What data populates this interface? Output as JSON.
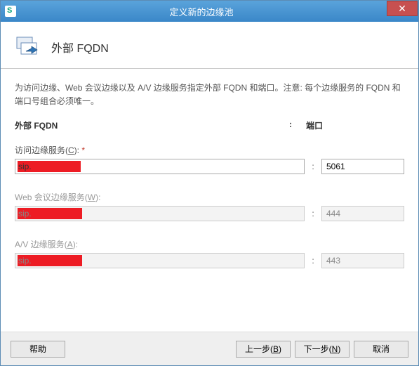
{
  "window": {
    "title": "定义新的边缘池"
  },
  "header": {
    "title": "外部 FQDN"
  },
  "description": "为访问边缘、Web 会议边缘以及 A/V 边缘服务指定外部 FQDN 和端口。注意: 每个边缘服务的 FQDN 和端口号组合必须唯一。",
  "columns": {
    "fqdn": "外部 FQDN",
    "colon": ":",
    "port": "端口"
  },
  "fields": {
    "access": {
      "label_pre": "访问边缘服务(",
      "label_hot": "C",
      "label_post": "):",
      "required_mark": " *",
      "fqdn": "sip.",
      "port": "5061",
      "enabled": true
    },
    "webconf": {
      "label_pre": "Web 会议边缘服务(",
      "label_hot": "W",
      "label_post": "):",
      "fqdn": "sip.",
      "port": "444",
      "enabled": false
    },
    "av": {
      "label_pre": "A/V 边缘服务(",
      "label_hot": "A",
      "label_post": "):",
      "fqdn": "sip.",
      "port": "443",
      "enabled": false
    }
  },
  "footer": {
    "help": "帮助",
    "back_pre": "上一步(",
    "back_hot": "B",
    "back_post": ")",
    "next_pre": "下一步(",
    "next_hot": "N",
    "next_post": ")",
    "cancel": "取消"
  }
}
